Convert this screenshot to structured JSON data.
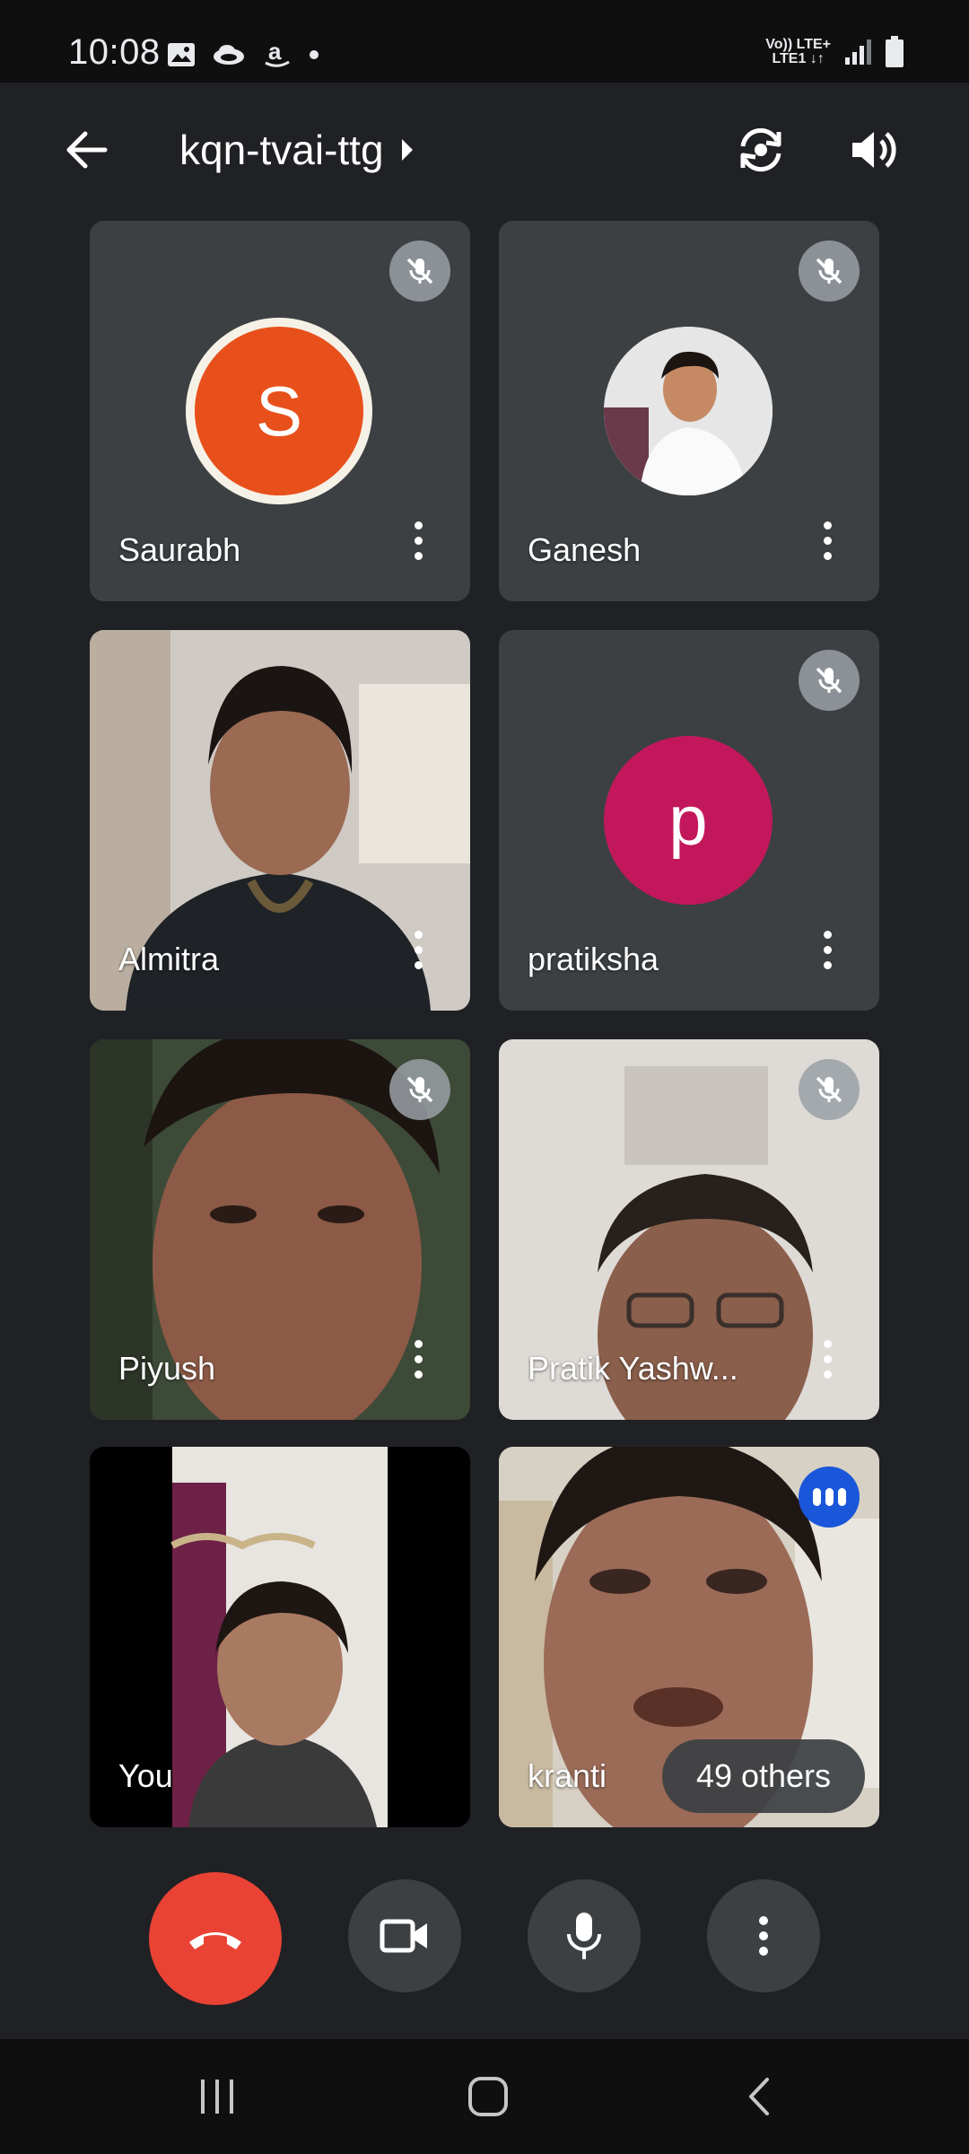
{
  "status_bar": {
    "time": "10:08",
    "left_icons": [
      "image-icon",
      "cloud-icon",
      "amazon-icon",
      "dot-icon"
    ],
    "network_top": "Vo)) LTE+",
    "network_bottom": "LTE1 ↓↑",
    "right_icons": [
      "signal-icon",
      "battery-icon"
    ]
  },
  "app_bar": {
    "meeting_code": "kqn-tvai-ttg",
    "icons": [
      "back-arrow-icon",
      "caret-right-icon",
      "switch-camera-icon",
      "speaker-icon"
    ]
  },
  "participants": [
    {
      "name": "Saurabh",
      "type": "avatar",
      "initial": "S",
      "muted": true,
      "avatar_color": "#e8501b"
    },
    {
      "name": "Ganesh",
      "type": "photo",
      "muted": true
    },
    {
      "name": "Almitra",
      "type": "video",
      "muted": false
    },
    {
      "name": "pratiksha",
      "type": "avatar",
      "initial": "p",
      "muted": true,
      "avatar_color": "#c2185b"
    },
    {
      "name": "Piyush",
      "type": "video",
      "muted": true
    },
    {
      "name": "Pratik Yashw...",
      "type": "video",
      "muted": true
    },
    {
      "name": "You",
      "type": "video",
      "muted": false
    },
    {
      "name": "kranti",
      "type": "video",
      "muted": false,
      "speaking": true
    }
  ],
  "others_label": "49 others",
  "controls": {
    "icons": [
      "end-call-icon",
      "video-camera-icon",
      "microphone-icon",
      "more-options-icon"
    ]
  },
  "colors": {
    "background": "#202124",
    "tile": "#3c4043",
    "end_call": "#ea4335",
    "speaking_badge": "#1a56d9"
  },
  "nav_bar": {
    "icons": [
      "recent-apps-icon",
      "home-icon",
      "back-icon"
    ]
  }
}
